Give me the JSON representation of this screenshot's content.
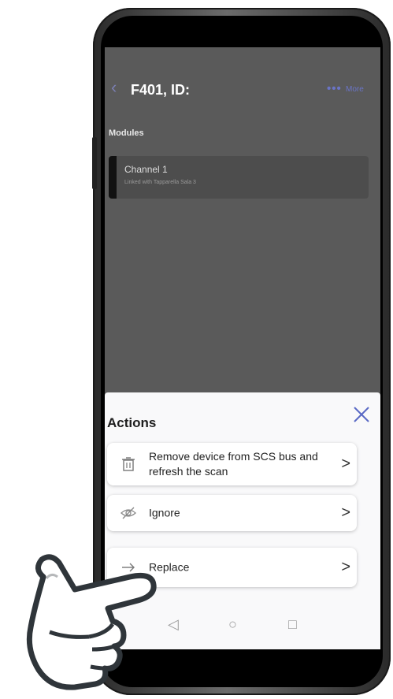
{
  "header": {
    "back_icon": "chevron-left-icon",
    "title": "F401, ID:",
    "more_dots": "•••",
    "more_label": "More"
  },
  "modules": {
    "section_title": "Modules",
    "items": [
      {
        "title": "Channel 1",
        "subtitle": "Linked with Tapparella Sala 3"
      }
    ]
  },
  "sheet": {
    "title": "Actions",
    "close_icon": "close-x-icon",
    "actions": [
      {
        "label": "Remove device from SCS bus and refresh the scan",
        "icon": "trash-icon"
      },
      {
        "label": "Ignore",
        "icon": "eye-off-icon"
      },
      {
        "label": "Replace",
        "icon": "arrow-right-icon"
      }
    ],
    "chevron": ">"
  },
  "navbar": {
    "back": "◁",
    "home": "○",
    "recent": "□"
  },
  "colors": {
    "accent": "#5868c4",
    "overlay": "#5a5a5a",
    "sheet": "#f9f9fa"
  }
}
